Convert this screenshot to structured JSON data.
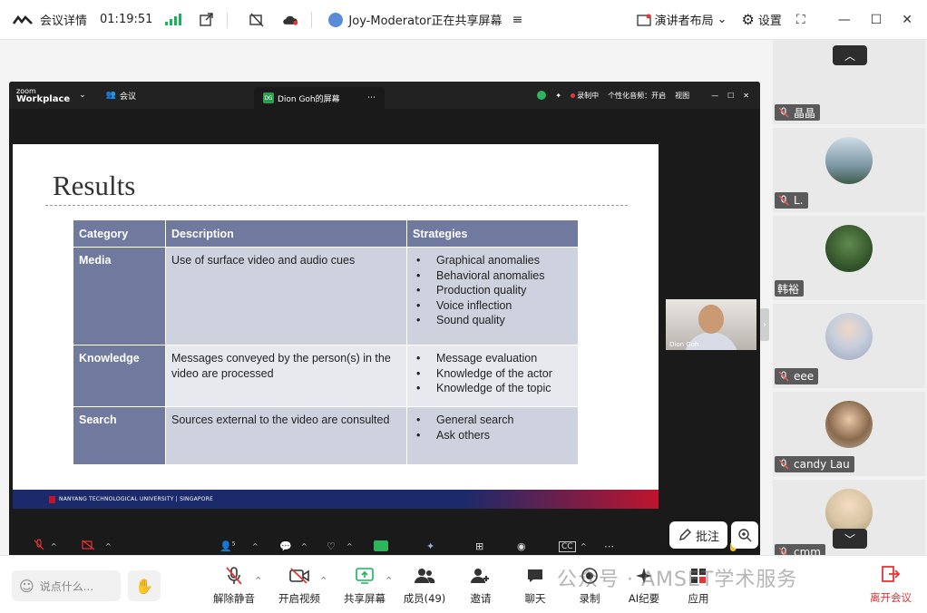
{
  "topbar": {
    "meeting_details": "会议详情",
    "timer": "01:19:51",
    "sharing_status": "Joy-Moderator正在共享屏幕",
    "presenter_layout": "演讲者布局",
    "settings": "设置"
  },
  "zoom_window": {
    "brand_small": "zoom",
    "brand": "Workplace",
    "meeting": "会议",
    "tab_title": "Dion Goh的屏幕",
    "tab_badge": "DG",
    "recording": "录制中",
    "audio_label": "个性化音频：开启",
    "view": "视图",
    "speaker_name": "Dion Goh"
  },
  "slide": {
    "title": "Results",
    "headers": [
      "Category",
      "Description",
      "Strategies"
    ],
    "rows": [
      {
        "category": "Media",
        "description": "Use of surface video and audio cues",
        "strategies": [
          "Graphical anomalies",
          "Behavioral anomalies",
          "Production quality",
          "Voice inflection",
          "Sound quality"
        ]
      },
      {
        "category": "Knowledge",
        "description": "Messages conveyed by the person(s) in the video are processed",
        "strategies": [
          "Message evaluation",
          "Knowledge of the actor",
          "Knowledge of the topic"
        ]
      },
      {
        "category": "Search",
        "description": "Sources external to the video are consulted",
        "strategies": [
          "General search",
          "Ask others"
        ]
      }
    ],
    "footer": "NANYANG TECHNOLOGICAL UNIVERSITY | SINGAPORE"
  },
  "zoom_bottom": {
    "participants_count": "5"
  },
  "annotate": "批注",
  "participants": [
    {
      "name": "晶晶",
      "muted": true,
      "color": "#7a8a6a"
    },
    {
      "name": "L.",
      "muted": true,
      "color": "#8fa7b8"
    },
    {
      "name": "韩裕",
      "muted": false,
      "color": "#3f6b3a"
    },
    {
      "name": "eee",
      "muted": true,
      "color": "#c9cdd8"
    },
    {
      "name": "candy Lau",
      "muted": true,
      "color": "#a08466"
    },
    {
      "name": "cmm",
      "muted": true,
      "color": "#b9a889"
    }
  ],
  "toolbar": {
    "chat_placeholder": "说点什么...",
    "items": [
      {
        "label": "解除静音"
      },
      {
        "label": "开启视频"
      },
      {
        "label": "共享屏幕"
      },
      {
        "label": "成员(49)"
      },
      {
        "label": "邀请"
      },
      {
        "label": "聊天"
      },
      {
        "label": "录制"
      },
      {
        "label": "AI纪要"
      },
      {
        "label": "应用"
      }
    ],
    "leave": "离开会议"
  },
  "watermark": "公众号 · AMSET学术服务",
  "colors": {
    "accent_green": "#19b35a",
    "danger": "#e43535",
    "table_header": "#6f7a9e"
  }
}
